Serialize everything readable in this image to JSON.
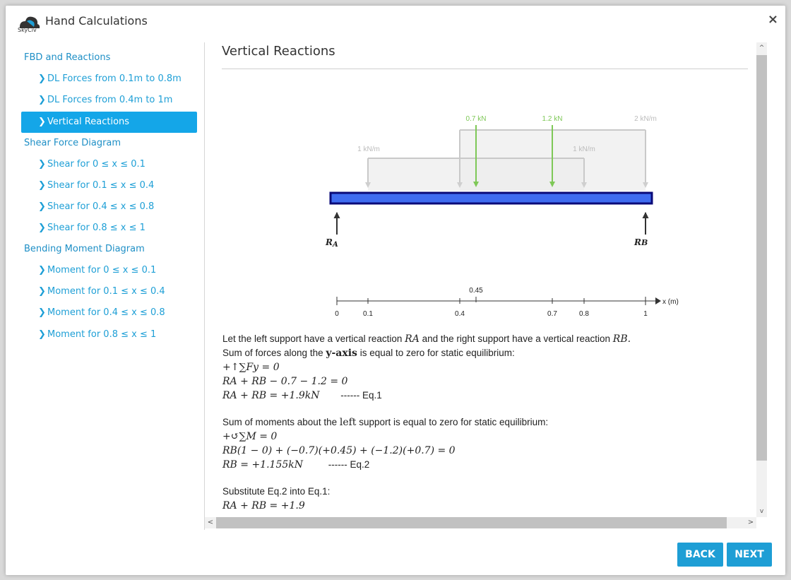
{
  "window": {
    "title": "Hand Calculations",
    "logo_text": "SkyCiv",
    "close_glyph": "×"
  },
  "sidebar": {
    "items": [
      {
        "label": "FBD and Reactions",
        "kind": "section"
      },
      {
        "label": "DL Forces from 0.1m to 0.8m",
        "kind": "sub"
      },
      {
        "label": "DL Forces from 0.4m to 1m",
        "kind": "sub"
      },
      {
        "label": "Vertical Reactions",
        "kind": "sub",
        "active": true
      },
      {
        "label": "Shear Force Diagram",
        "kind": "section"
      },
      {
        "label": "Shear for 0 ≤ x ≤ 0.1",
        "kind": "sub"
      },
      {
        "label": "Shear for 0.1 ≤ x ≤ 0.4",
        "kind": "sub"
      },
      {
        "label": "Shear for 0.4 ≤ x ≤ 0.8",
        "kind": "sub"
      },
      {
        "label": "Shear for 0.8 ≤ x ≤ 1",
        "kind": "sub"
      },
      {
        "label": "Bending Moment Diagram",
        "kind": "section"
      },
      {
        "label": "Moment for 0 ≤ x ≤ 0.1",
        "kind": "sub"
      },
      {
        "label": "Moment for 0.1 ≤ x ≤ 0.4",
        "kind": "sub"
      },
      {
        "label": "Moment for 0.4 ≤ x ≤ 0.8",
        "kind": "sub"
      },
      {
        "label": "Moment for 0.8 ≤ x ≤ 1",
        "kind": "sub"
      }
    ]
  },
  "content": {
    "heading": "Vertical Reactions",
    "diagram": {
      "point_loads": [
        "0.7 kN",
        "1.2 kN"
      ],
      "udl_labels": [
        "1 kN/m",
        "1 kN/m",
        "2 kN/m"
      ],
      "reactions": [
        "R",
        "A",
        "R",
        "B"
      ],
      "axis": {
        "label": "x (m)",
        "top_tick": "0.45",
        "ticks": [
          "0",
          "0.1",
          "0.4",
          "0.7",
          "0.8",
          "1"
        ]
      },
      "colors": {
        "beam": "#3f6cf0",
        "beam_edge": "#0a0a78",
        "load": "#7ec857",
        "udl": "#c9c9c9",
        "reaction": "#333333"
      }
    },
    "p1": "Let the left support have a vertical reaction",
    "p1_mid": "and the right support have a vertical reaction",
    "p1_ra": "RA",
    "p1_rb": "RB.",
    "p2a": "Sum of forces along the",
    "p2b": "y-axis",
    "p2c": "is equal to zero for static equilibrium:",
    "eq1": "+↑∑Fy = 0",
    "eq2": "RA + RB − 0.7 − 1.2 = 0",
    "eq3": "RA + RB = +1.9kN",
    "eq3_tag": "------ Eq.1",
    "p3a": "Sum of moments about the",
    "p3b": "left",
    "p3c": "support is equal to zero for static equilibrium:",
    "eq4": "+↺∑M = 0",
    "eq5": "RB(1 − 0) + (−0.7)(+0.45) + (−1.2)(+0.7) = 0",
    "eq6": "RB = +1.155kN",
    "eq6_tag": "------ Eq.2",
    "p4": "Substitute Eq.2 into Eq.1:",
    "eq7": "RA + RB = +1.9"
  },
  "scroll": {
    "up": "^",
    "down": "v",
    "left": "<",
    "right": ">"
  },
  "buttons": {
    "back": "BACK",
    "next": "NEXT"
  }
}
